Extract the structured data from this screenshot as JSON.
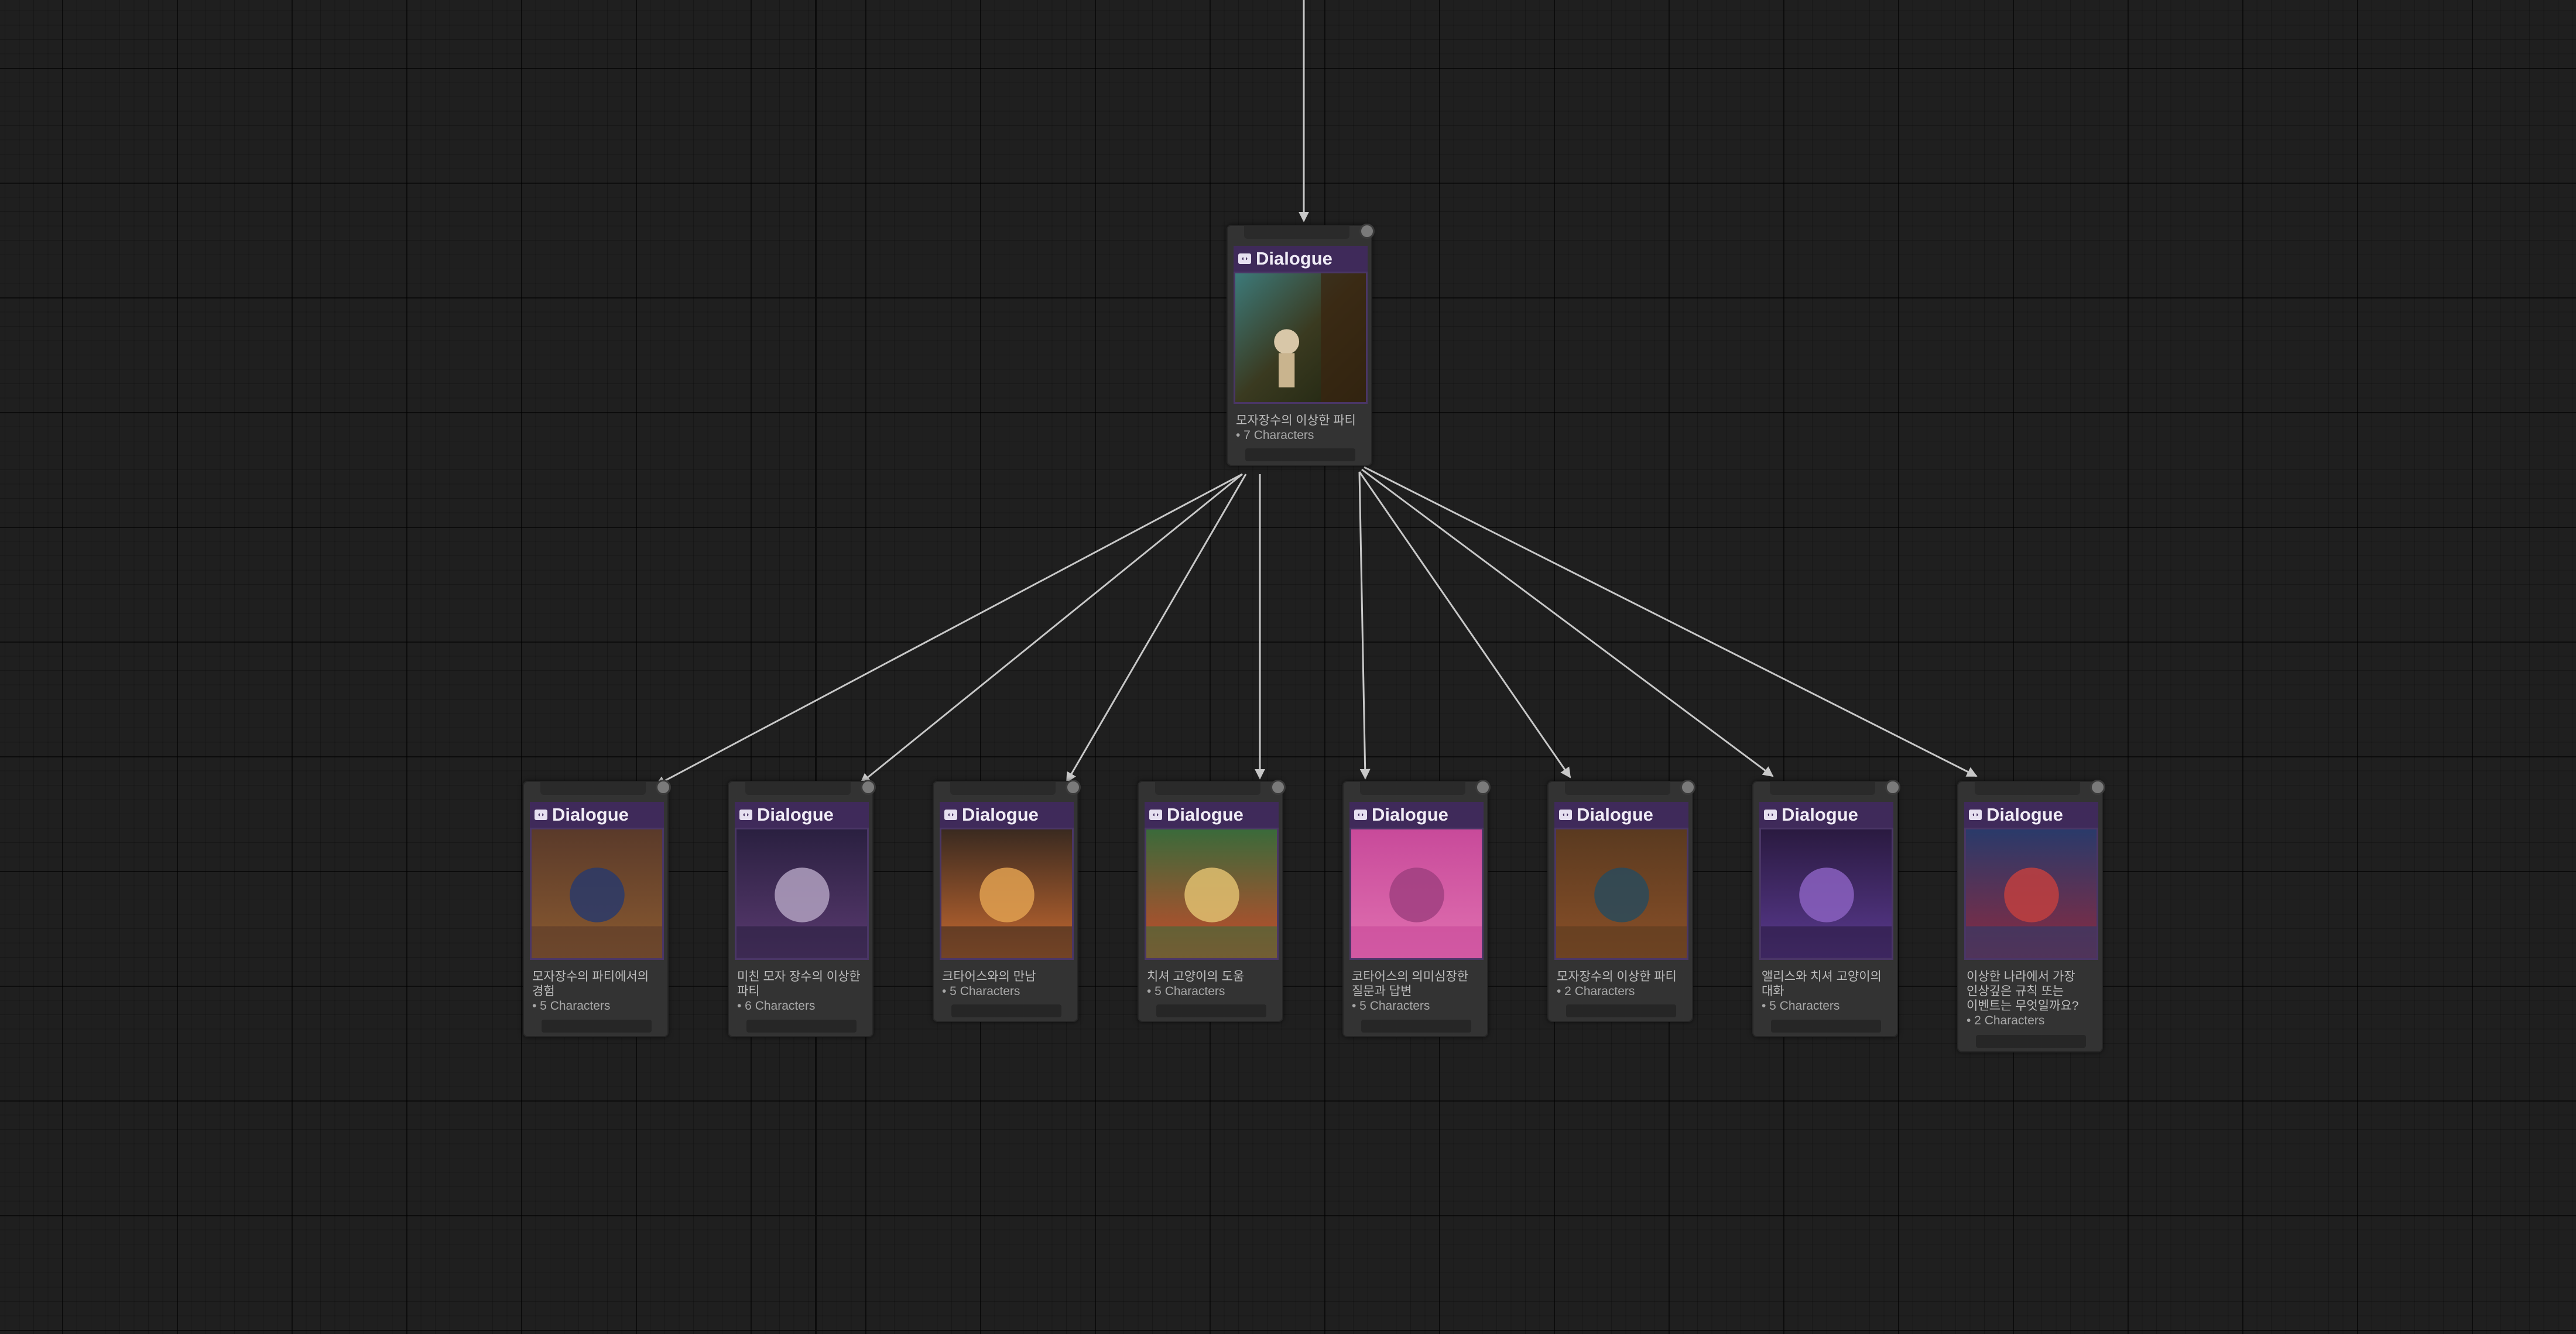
{
  "canvas": {
    "background": "#1f1f1f",
    "header_color": "#3f2a5a",
    "edge_color": "#c8c8c8"
  },
  "root": {
    "title": "Dialogue",
    "icon": "dialogue-icon",
    "line1": "모자장수의 이상한 파티",
    "line2": "",
    "count": "• 7 Characters"
  },
  "children": [
    {
      "title": "Dialogue",
      "icon": "dialogue-icon",
      "line1": "모자장수의 파티에서의",
      "line2": "경험",
      "line3": "",
      "count": "• 5 Characters"
    },
    {
      "title": "Dialogue",
      "icon": "dialogue-icon",
      "line1": "미친 모자 장수의 이상한",
      "line2": "파티",
      "line3": "",
      "count": "• 6 Characters"
    },
    {
      "title": "Dialogue",
      "icon": "dialogue-icon",
      "line1": "크타어스와의 만남",
      "line2": "",
      "line3": "",
      "count": "• 5 Characters"
    },
    {
      "title": "Dialogue",
      "icon": "dialogue-icon",
      "line1": "치셔 고양이의 도움",
      "line2": "",
      "line3": "",
      "count": "• 5 Characters"
    },
    {
      "title": "Dialogue",
      "icon": "dialogue-icon",
      "line1": "코타어스의 의미심장한",
      "line2": "질문과 답변",
      "line3": "",
      "count": "• 5 Characters"
    },
    {
      "title": "Dialogue",
      "icon": "dialogue-icon",
      "line1": "모자장수의 이상한 파티",
      "line2": "",
      "line3": "",
      "count": "• 2 Characters"
    },
    {
      "title": "Dialogue",
      "icon": "dialogue-icon",
      "line1": "앨리스와 치셔 고양이의",
      "line2": "대화",
      "line3": "",
      "count": "• 5 Characters"
    },
    {
      "title": "Dialogue",
      "icon": "dialogue-icon",
      "line1": "이상한 나라에서 가장",
      "line2": "인상깊은 규칙 또는",
      "line3": "이벤트는 무엇일까요?",
      "count": "• 2 Characters"
    }
  ]
}
